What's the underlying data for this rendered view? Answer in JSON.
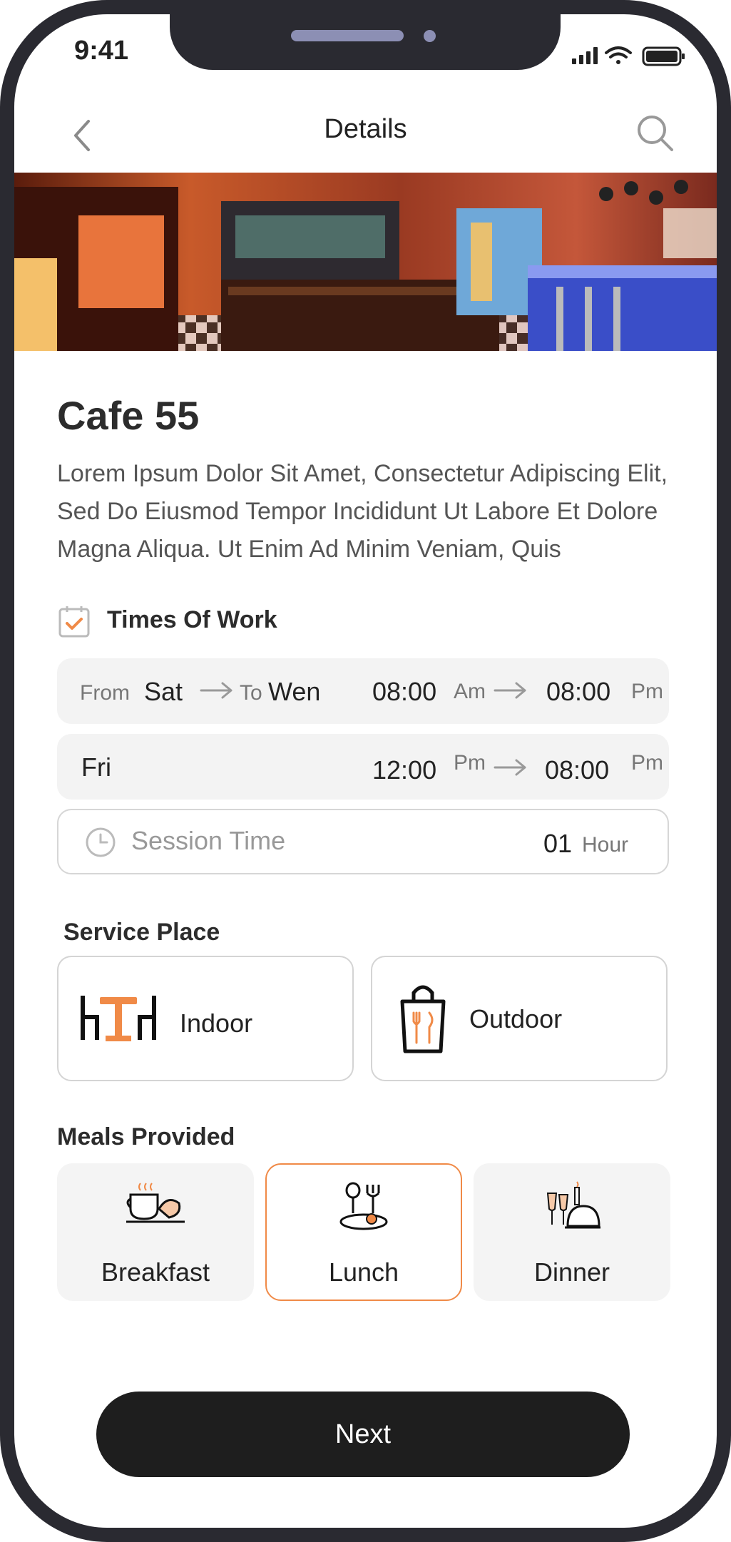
{
  "status_bar": {
    "time": "9:41"
  },
  "header": {
    "title": "Details",
    "back_icon": "chevron-left-icon",
    "search_icon": "search-icon"
  },
  "place": {
    "name": "Cafe 55",
    "description": "Lorem Ipsum Dolor Sit Amet, Consectetur Adipiscing Elit, Sed Do Eiusmod Tempor Incididunt Ut Labore Et Dolore Magna Aliqua. Ut Enim Ad Minim Veniam, Quis"
  },
  "times_of_work": {
    "label": "Times Of Work",
    "row1": {
      "from_label": "From",
      "from_day": "Sat",
      "to_label": "To",
      "to_day": "Wen",
      "start": "08:00",
      "start_period": "Am",
      "end": "08:00",
      "end_period": "Pm"
    },
    "row2": {
      "day": "Fri",
      "start": "12:00",
      "start_period": "Pm",
      "end": "08:00",
      "end_period": "Pm"
    },
    "session": {
      "label": "Session Time",
      "value": "01",
      "unit": "Hour"
    }
  },
  "service_place": {
    "label": "Service Place",
    "options": [
      {
        "label": "Indoor",
        "icon": "table-icon"
      },
      {
        "label": "Outdoor",
        "icon": "takeaway-bag-icon"
      }
    ]
  },
  "meals": {
    "label": "Meals Provided",
    "options": [
      {
        "label": "Breakfast",
        "icon": "coffee-cup-icon",
        "selected": false
      },
      {
        "label": "Lunch",
        "icon": "plate-cutlery-icon",
        "selected": true
      },
      {
        "label": "Dinner",
        "icon": "wine-dinner-icon",
        "selected": false
      }
    ]
  },
  "colors": {
    "accent": "#f08a47",
    "dark": "#1e1e1e"
  },
  "footer": {
    "next_label": "Next"
  }
}
